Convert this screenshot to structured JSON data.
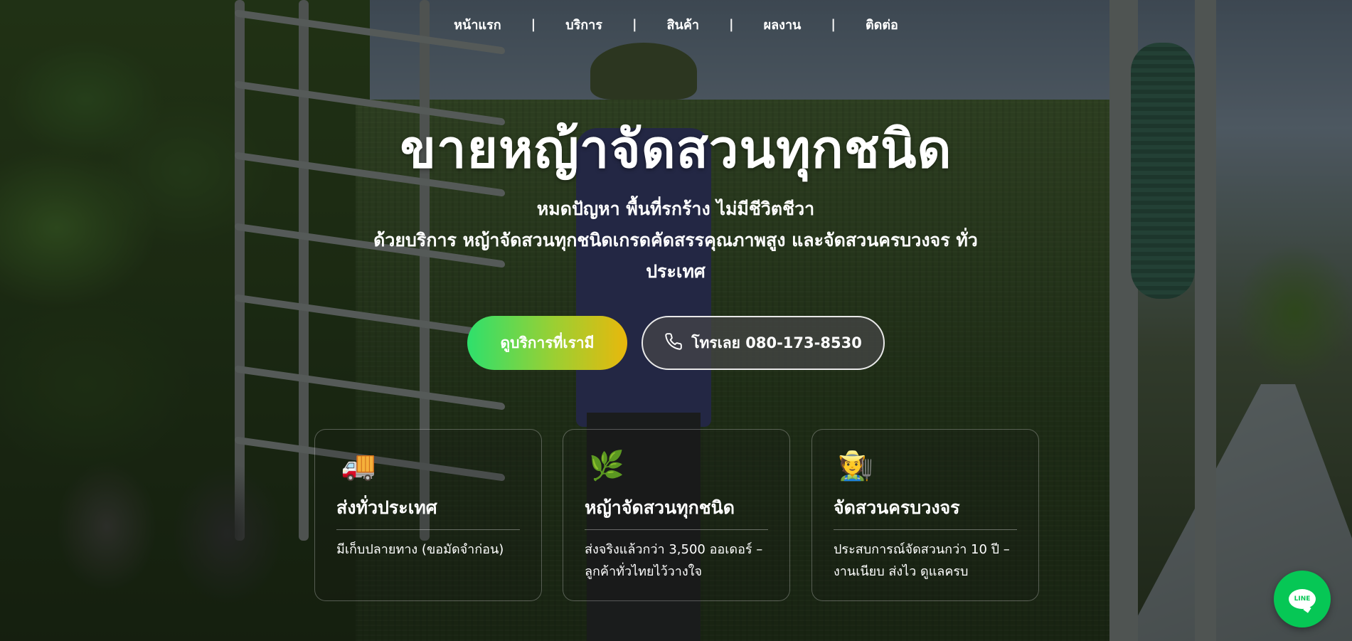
{
  "nav": {
    "items": [
      "หน้าแรก",
      "บริการ",
      "สินค้า",
      "ผลงาน",
      "ติดต่อ"
    ],
    "separator": "|"
  },
  "hero": {
    "title": "ขายหญ้าจัดสวนทุกชนิด",
    "subtitle_line1": "หมดปัญหา พื้นที่รกร้าง ไม่มีชีวิตชีวา",
    "subtitle_line2": "ด้วยบริการ หญ้าจัดสวนทุกชนิดเกรดคัดสรรคุณภาพสูง และจัดสวนครบวงจร ทั่ว",
    "subtitle_line3": "ประเทศ"
  },
  "buttons": {
    "primary_label": "ดูบริการที่เรามี",
    "call_label": "โทรเลย 080-173-8530",
    "call_icon": "phone-icon"
  },
  "cards": [
    {
      "icon": "🚚",
      "icon_name": "delivery-truck-icon",
      "title": "ส่งทั่วประเทศ",
      "text": "มีเก็บปลายทาง (ขอมัดจำก่อน)"
    },
    {
      "icon": "🌿",
      "icon_name": "herb-icon",
      "title": "หญ้าจัดสวนทุกชนิด",
      "text": "ส่งจริงแล้วกว่า 3,500 ออเดอร์ – ลูกค้าทั่วไทยไว้วางใจ"
    },
    {
      "icon": "🧑‍🌾",
      "icon_name": "farmer-icon",
      "title": "จัดสวนครบวงจร",
      "text": "ประสบการณ์จัดสวนกว่า 10 ปี – งานเนียบ ส่งไว ดูแลครบ"
    }
  ],
  "line_button": {
    "label": "LINE",
    "icon_name": "line-chat-icon",
    "color": "#06c755"
  },
  "colors": {
    "primary_gradient_start": "#2ee06c",
    "primary_gradient_end": "#e8b80c"
  }
}
